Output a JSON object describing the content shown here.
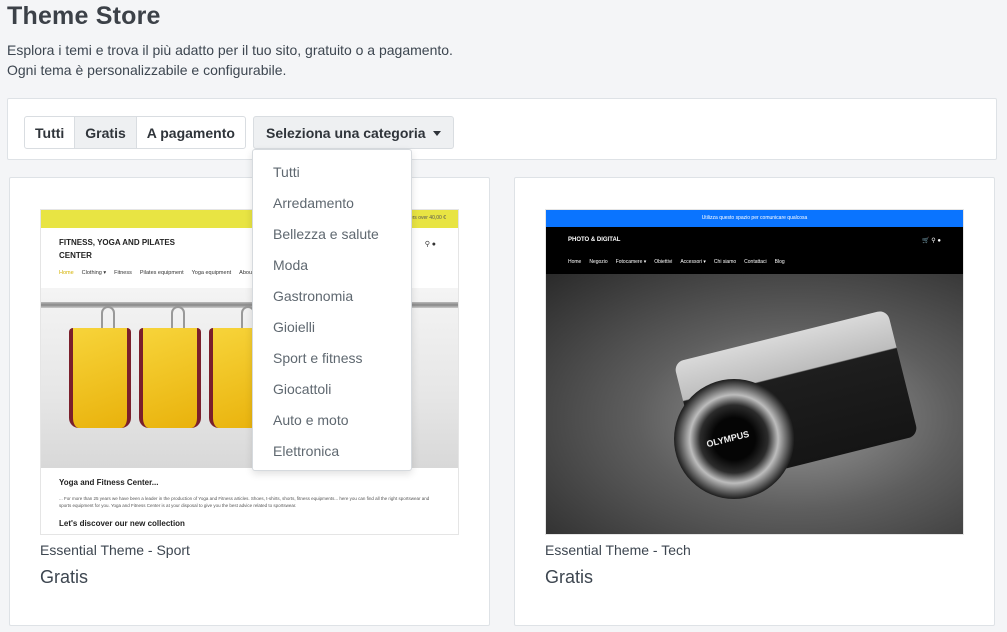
{
  "header": {
    "title": "Theme Store",
    "description_line1": "Esplora i temi e trova il più adatto per il tuo sito, gratuito o a pagamento.",
    "description_line2": "Ogni tema è personalizzabile e configurabile."
  },
  "filters": {
    "price_tabs": [
      {
        "label": "Tutti"
      },
      {
        "label": "Gratis"
      },
      {
        "label": "A pagamento"
      }
    ],
    "active_tab": "Gratis",
    "category_toggle_label": "Seleziona una categoria"
  },
  "category_menu": [
    "Tutti",
    "Arredamento",
    "Bellezza e salute",
    "Moda",
    "Gastronomia",
    "Gioielli",
    "Sport e fitness",
    "Giocattoli",
    "Auto e moto",
    "Elettronica"
  ],
  "themes": [
    {
      "name": "Essential Theme - Sport",
      "price": "Gratis",
      "preview": {
        "topbar": "Free shipping for orders over 40,00 €",
        "logo": "FITNESS, YOGA AND PILATES CENTER",
        "nav": [
          "Home",
          "Clothing ▾",
          "Fitness",
          "Pilates equipment",
          "Yoga equipment",
          "About"
        ],
        "headline": "Yoga and Fitness Center...",
        "paragraph": "... For more than 25 years we have been a leader in the production of Yoga and Fitness articles. Shoes, t-shirts, shorts, fitness equipments... here you can find all the right sportswear and sports equipment for you. Yoga and Fitness Center is at your disposal to give you the best advice related to sportswear.",
        "subheadline": "Let's discover our new collection"
      }
    },
    {
      "name": "Essential Theme - Tech",
      "price": "Gratis",
      "preview": {
        "topbar": "Utilizza questo spazio per comunicare qualcosa",
        "logo": "PHOTO & DIGITAL",
        "nav": [
          "Home",
          "Negozio",
          "Fotocamere ▾",
          "Obiettivi",
          "Accessori ▾",
          "Chi siamo",
          "Contattaci",
          "Blog"
        ],
        "camera_brand": "OLYMPUS"
      }
    }
  ],
  "colors": {
    "page_bg": "#f4f5f7",
    "sport_topbar": "#e8e443",
    "tech_topbar": "#0a74ff"
  }
}
